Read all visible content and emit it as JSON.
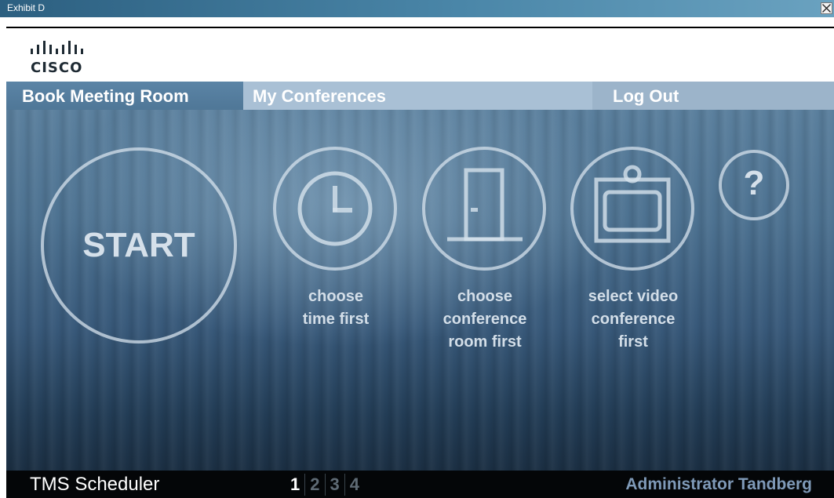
{
  "window": {
    "title": "Exhibit D"
  },
  "header": {
    "brand": "CISCO"
  },
  "nav": {
    "tabs": [
      {
        "label": "Book Meeting Room",
        "active": true
      },
      {
        "label": "My Conferences",
        "active": false
      },
      {
        "label": "Log Out",
        "active": false
      }
    ]
  },
  "main": {
    "start_label": "START",
    "help_label": "?",
    "options": [
      {
        "icon": "clock-icon",
        "caption_lines": [
          "choose",
          "time first"
        ]
      },
      {
        "icon": "door-icon",
        "caption_lines": [
          "choose",
          "conference",
          "room first"
        ]
      },
      {
        "icon": "video-endpoint-icon",
        "caption_lines": [
          "select video",
          "conference",
          "first"
        ]
      }
    ]
  },
  "footer": {
    "app_name": "TMS Scheduler",
    "steps": [
      "1",
      "2",
      "3",
      "4"
    ],
    "current_step": "1",
    "user": "Administrator Tandberg"
  },
  "colors": {
    "nav_bar": "#a9c0d5",
    "active_tab": "#5b84a6",
    "footer": "#040608",
    "user_name": "#7f9ab8"
  }
}
